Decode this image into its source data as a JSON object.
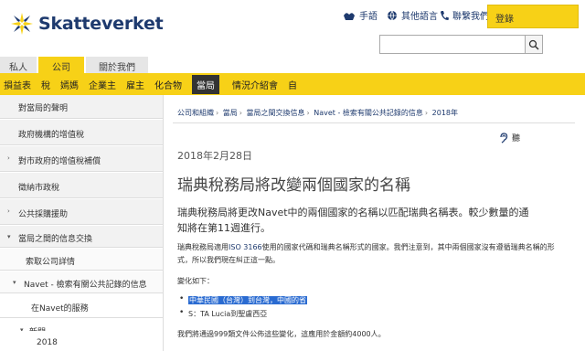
{
  "header": {
    "logo_text": "Skatteverket",
    "utility": [
      {
        "label": "手語",
        "icon": "sign-language-icon"
      },
      {
        "label": "其他語言",
        "icon": "globe-icon"
      },
      {
        "label": "聯繫我們",
        "icon": "phone-icon"
      }
    ],
    "login_label": "登錄",
    "search_placeholder": ""
  },
  "tabs": [
    "私人",
    "公司",
    "關於我們"
  ],
  "nav": [
    "損益表",
    "稅",
    "嫣媽",
    "企業主",
    "雇主",
    "化合物",
    "當局",
    "情況介紹會",
    "自"
  ],
  "sidebar": [
    {
      "label": "對當局的聲明",
      "level": 1,
      "chevron": ""
    },
    {
      "label": "政府機構的增值稅",
      "level": 1,
      "chevron": ""
    },
    {
      "label": "對市政府的增值稅補償",
      "level": 1,
      "chevron": "›"
    },
    {
      "label": "徵納市政稅",
      "level": 1,
      "chevron": ""
    },
    {
      "label": "公共採購援助",
      "level": 1,
      "chevron": "›"
    },
    {
      "label": "當局之間的信息交換",
      "level": 1,
      "chevron": "▾"
    },
    {
      "label": "索取公司詳情",
      "level": 2,
      "chevron": ""
    },
    {
      "label": "Navet - 檢索有關公共記錄的信息",
      "level": 2,
      "chevron": "▾"
    },
    {
      "label": "在Navet的服務",
      "level": 3,
      "chevron": ""
    },
    {
      "label": "新聞",
      "level": 3,
      "chevron": "▾"
    },
    {
      "label": "2018",
      "level": 4,
      "chevron": ""
    }
  ],
  "breadcrumb": [
    "公司和組織",
    "當局",
    "當局之間交換信息",
    "Navet - 檢索有關公共記錄的信息",
    "2018年"
  ],
  "listen_label": "聽",
  "article": {
    "date": "2018年2月28日",
    "title": "瑞典稅務局將改變兩個國家的名稱",
    "lead": "瑞典稅務局將更改Navet中的兩個國家的名稱以匹配瑞典名稱表。較少數量的通知將在第11週進行。",
    "body1_pre": "瑞典稅務局適用",
    "body1_link": "ISO 3166",
    "body1_post": "使用的國家代碼和瑞典名稱形式的國家。我們注意到，其中兩個國家沒有遵循瑞典名稱的形式，所以我們現在糾正這一點。",
    "body2": "變化如下：",
    "bullets": [
      {
        "text": "中華民國（台灣）到台灣，中國的省",
        "highlighted": true
      },
      {
        "text": "S：TA Lucia到聖盧西亞",
        "highlighted": false
      }
    ],
    "body3": "我們將通過999類文件公佈這些變化，這應用於金額約4000人。"
  },
  "colors": {
    "brand_yellow": "#f7d117",
    "brand_blue": "#1e3a6e",
    "highlight": "#2a6bd1"
  }
}
